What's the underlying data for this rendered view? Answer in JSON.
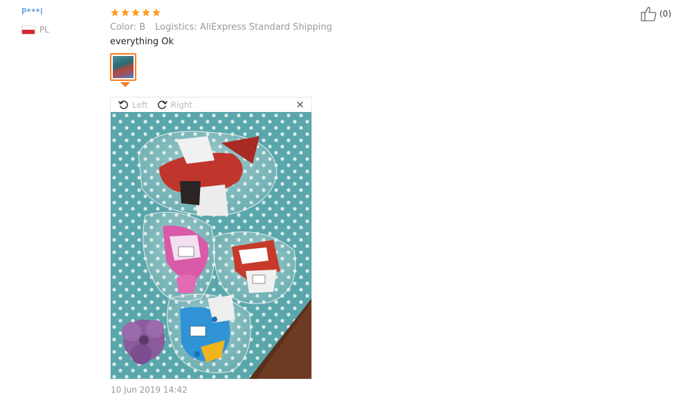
{
  "user": {
    "name": "P***l",
    "country": "PL",
    "flag_colors": [
      "#ffffff",
      "#d7282f"
    ]
  },
  "review": {
    "rating": 5,
    "star_color": "#ff9a1f",
    "color_label": "Color: B",
    "logistics_label": "Logistics: AliExpress Standard Shipping",
    "text": "everything Ok",
    "date": "10 Jun 2019 14:42"
  },
  "viewer": {
    "rotate_left_label": "Left",
    "rotate_right_label": "Right",
    "close_label": "×",
    "accent_color": "#ff7a1a"
  },
  "like": {
    "count_label": "(0)"
  }
}
